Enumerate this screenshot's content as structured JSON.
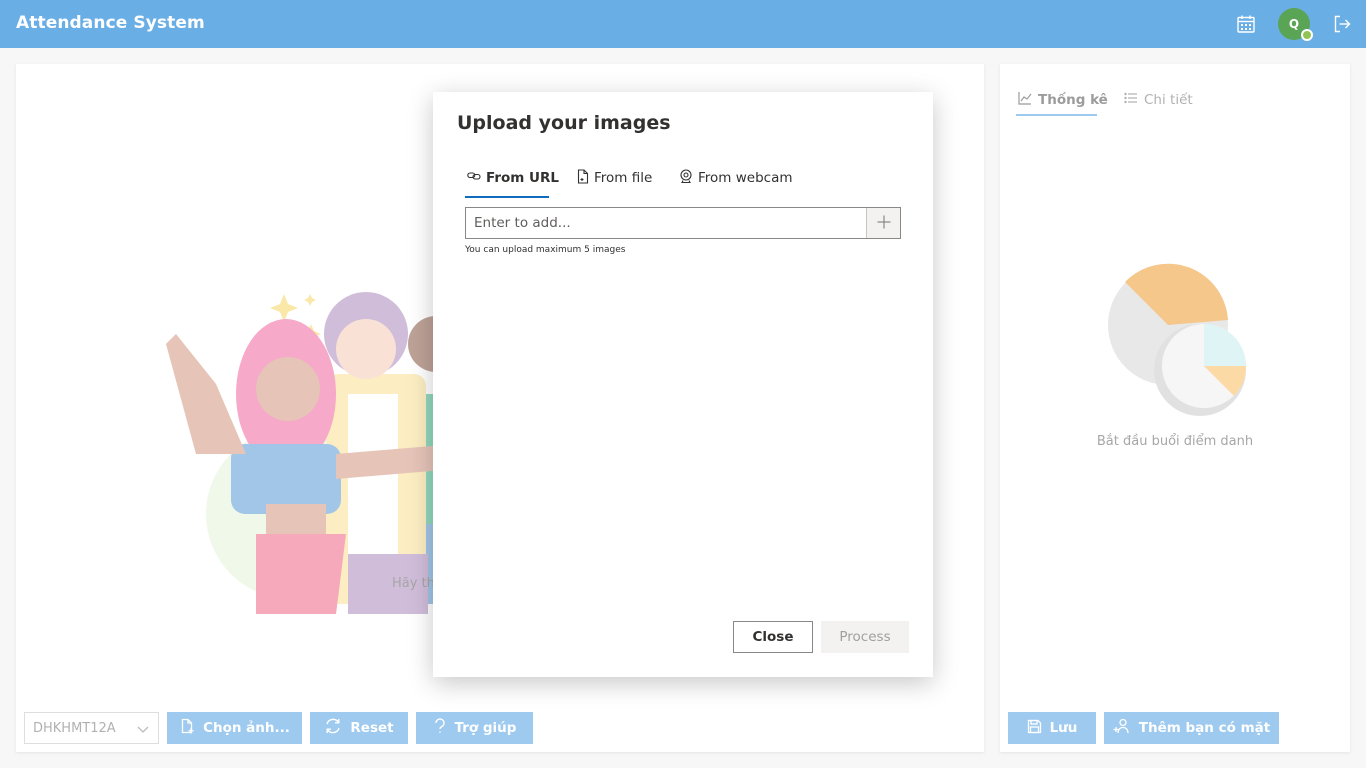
{
  "header": {
    "app_title": "Attendance System",
    "avatar_initial": "Q",
    "icons": [
      "calendar-icon",
      "avatar",
      "sign-out-icon"
    ]
  },
  "left_panel": {
    "hint_text": "Hãy th",
    "class_select_value": "DHKHMT12A",
    "buttons": {
      "choose_image": "Chọn ảnh...",
      "reset": "Reset",
      "help": "Trợ giúp"
    }
  },
  "right_panel": {
    "tabs": [
      {
        "label": "Thống kê",
        "icon": "chart-icon",
        "active": true
      },
      {
        "label": "Chi tiết",
        "icon": "list-icon",
        "active": false
      }
    ],
    "empty_caption": "Bắt đầu buổi điểm danh",
    "buttons": {
      "save": "Lưu",
      "add_present": "Thêm bạn có mặt"
    }
  },
  "dialog": {
    "title": "Upload your images",
    "tabs": [
      {
        "label": "From URL",
        "icon": "link-icon",
        "active": true
      },
      {
        "label": "From file",
        "icon": "file-icon",
        "active": false
      },
      {
        "label": "From webcam",
        "icon": "webcam-icon",
        "active": false
      }
    ],
    "url_input": {
      "value": "",
      "placeholder": "Enter to add..."
    },
    "upload_note": "You can upload maximum 5 images",
    "close_label": "Close",
    "process_label": "Process"
  },
  "colors": {
    "header": "#6aaee6",
    "accent": "#0f6cbd",
    "avatar": "#5aa455",
    "status_online": "#92c353"
  }
}
